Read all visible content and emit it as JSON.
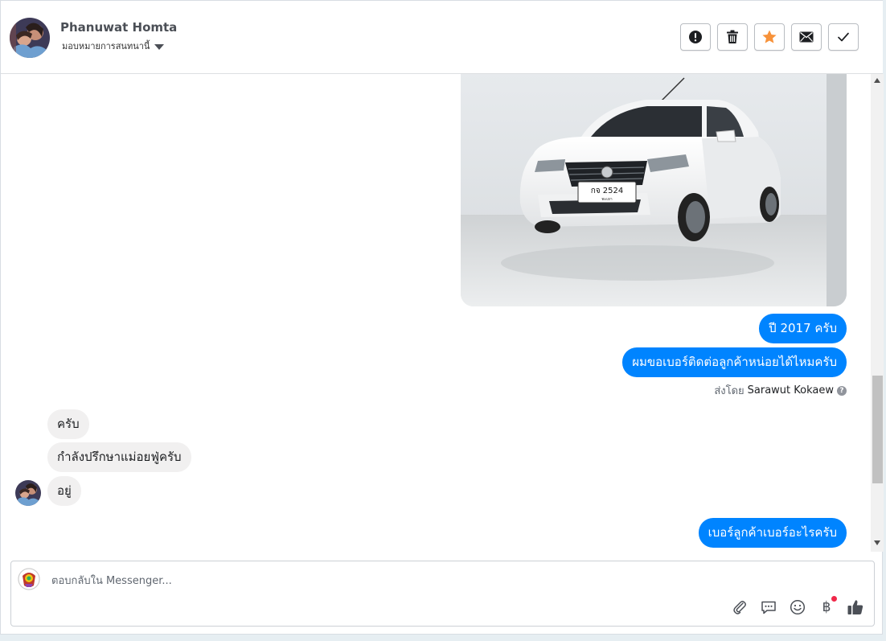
{
  "header": {
    "contact_name": "Phanuwat Homta",
    "assign_label": "มอบหมายการสนทนานี้",
    "actions": [
      {
        "name": "mark-spam-button",
        "icon": "exclamation-icon"
      },
      {
        "name": "delete-button",
        "icon": "trash-icon"
      },
      {
        "name": "star-button",
        "icon": "star-icon"
      },
      {
        "name": "mark-unread-button",
        "icon": "envelope-icon"
      },
      {
        "name": "mark-done-button",
        "icon": "check-icon"
      }
    ]
  },
  "messages": {
    "out1": "ปี 2017 ครับ",
    "out2": "ผมขอเบอร์ติดต่อลูกค้าหน่อยได้ไหมครับ",
    "sent_by_label": "ส่งโดย",
    "sent_by_name": "Sarawut Kokaew",
    "in1": "ครับ",
    "in2": "กำลังปรึกษาแม่อยฟู่ครับ",
    "in3": "อยู่",
    "out3": "เบอร์ลูกค้าเบอร์อะไรครับ"
  },
  "car_photo": {
    "plate_text": "กจ 2524",
    "plate_sub": "พะเยา"
  },
  "composer": {
    "placeholder": "ตอบกลับใน Messenger...",
    "baht_symbol": "฿"
  },
  "colors": {
    "accent": "#0084ff",
    "star": "#f7923a",
    "notify_dot": "#f02849"
  }
}
